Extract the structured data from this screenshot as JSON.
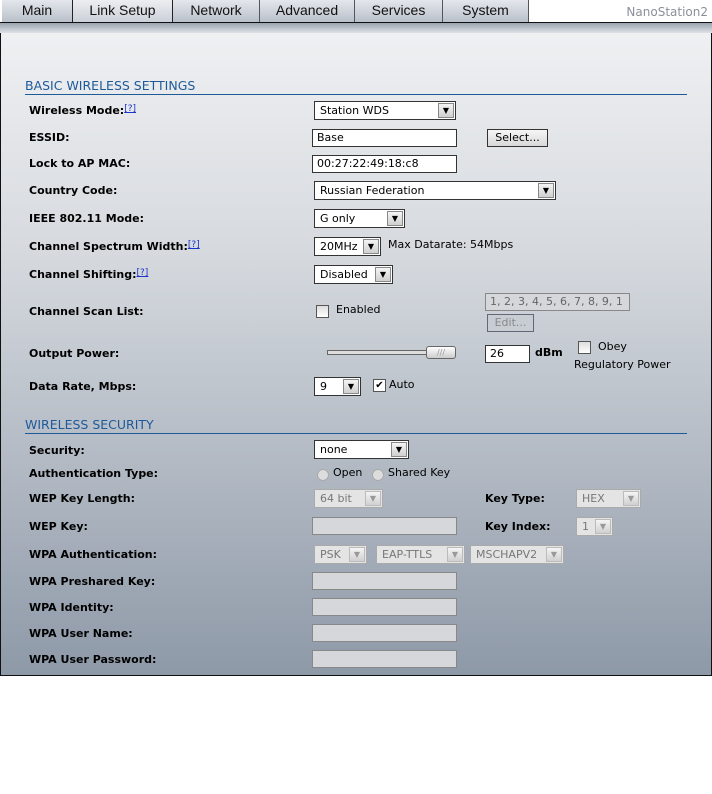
{
  "tabs": [
    "Main",
    "Link Setup",
    "Network",
    "Advanced",
    "Services",
    "System"
  ],
  "active_tab": "Link Setup",
  "brand": "NanoStation2",
  "basic": {
    "title": "BASIC WIRELESS SETTINGS",
    "help": "[?]",
    "wireless_mode_label": "Wireless Mode:",
    "wireless_mode": "Station WDS",
    "essid_label": "ESSID:",
    "essid": "Base",
    "select_button": "Select...",
    "lock_label": "Lock to AP MAC:",
    "lock_mac": "00:27:22:49:18:c8",
    "country_label": "Country Code:",
    "country": "Russian Federation",
    "ieee_label": "IEEE 802.11 Mode:",
    "ieee": "G only",
    "spectrum_label": "Channel Spectrum Width:",
    "spectrum": "20MHz",
    "max_datarate": "Max Datarate: 54Mbps",
    "shifting_label": "Channel Shifting:",
    "shifting": "Disabled",
    "scan_label": "Channel Scan List:",
    "scan_enabled_label": "Enabled",
    "scan_list": "1, 2, 3, 4, 5, 6, 7, 8, 9, 1",
    "edit_button": "Edit...",
    "power_label": "Output Power:",
    "power": "26",
    "power_unit": "dBm",
    "power_fraction": 1.0,
    "obey_label": "Obey",
    "regulatory_label": "Regulatory Power",
    "rate_label": "Data Rate, Mbps:",
    "rate": "9",
    "auto_label": "Auto",
    "auto_checked": true
  },
  "security": {
    "title": "WIRELESS SECURITY",
    "security_label": "Security:",
    "security": "none",
    "auth_label": "Authentication Type:",
    "auth_open": "Open",
    "auth_shared": "Shared Key",
    "wep_len_label": "WEP Key Length:",
    "wep_len": "64 bit",
    "key_type_label": "Key Type:",
    "key_type": "HEX",
    "wep_key_label": "WEP Key:",
    "key_index_label": "Key Index:",
    "key_index": "1",
    "wpa_auth_label": "WPA Authentication:",
    "wpa_auth": [
      "PSK",
      "EAP-TTLS",
      "MSCHAPV2"
    ],
    "psk_label": "WPA Preshared Key:",
    "identity_label": "WPA Identity:",
    "user_label": "WPA User Name:",
    "pass_label": "WPA User Password:"
  }
}
